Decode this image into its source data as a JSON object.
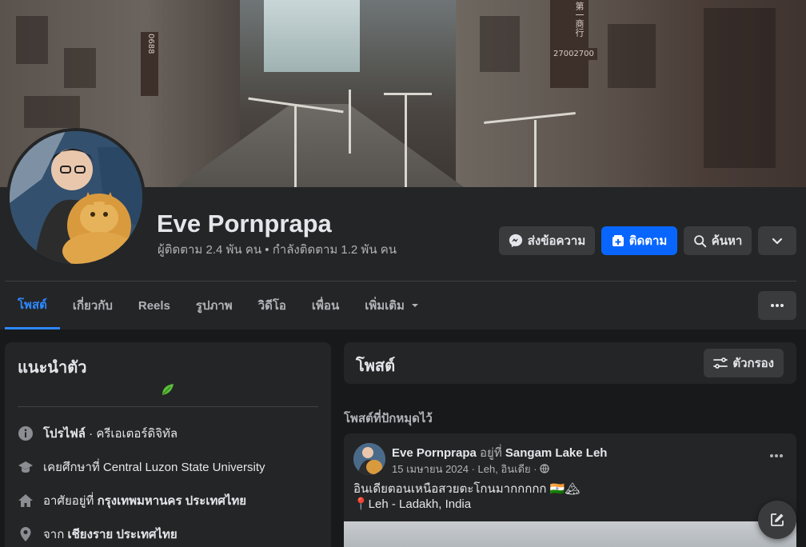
{
  "profile": {
    "name": "Eve Pornprapa",
    "stats": "ผู้ติดตาม 2.4 พัน คน • กำลังติดตาม 1.2 พัน คน"
  },
  "actions": {
    "message": "ส่งข้อความ",
    "follow": "ติดตาม",
    "search": "ค้นหา"
  },
  "tabs": [
    {
      "label": "โพสต์",
      "active": true
    },
    {
      "label": "เกี่ยวกับ"
    },
    {
      "label": "Reels"
    },
    {
      "label": "รูปภาพ"
    },
    {
      "label": "วิดีโอ"
    },
    {
      "label": "เพื่อน"
    },
    {
      "label": "เพิ่มเติม"
    }
  ],
  "intro": {
    "title": "แนะนำตัว",
    "rows": [
      {
        "icon": "info-icon",
        "bold": "โปรไฟล์",
        "text": " · ครีเอเตอร์ดิจิทัล"
      },
      {
        "icon": "graduation-cap-icon",
        "prefix": "เคยศึกษาที่ ",
        "bold": "Central Luzon State University"
      },
      {
        "icon": "home-icon",
        "prefix": "อาศัยอยู่ที่ ",
        "bold": "กรุงเทพมหานคร ประเทศไทย"
      },
      {
        "icon": "location-pin-icon",
        "prefix": "จาก ",
        "bold": "เชียงราย ประเทศไทย"
      }
    ]
  },
  "posts": {
    "title": "โพสต์",
    "filter": "ตัวกรอง",
    "pinned_label": "โพสต์ที่ปักหมุดไว้",
    "pinned_post": {
      "author": "Eve Pornprapa",
      "at": " อยู่ที่ ",
      "place": "Sangam Lake Leh",
      "meta": "15 เมษายน 2024 · Leh, อินเดีย · ",
      "line1": "อินเดียตอนเหนือสวยตะโกนมากกกกก 🇮🇳🏔",
      "line2": "📍Leh - Ladakh, India"
    }
  },
  "cover_signs": [
    "第一商行",
    "27002700",
    "0688"
  ],
  "colors": {
    "accent": "#0866ff",
    "active_tab": "#2d88ff",
    "background": "#18191a",
    "card": "#242526"
  }
}
